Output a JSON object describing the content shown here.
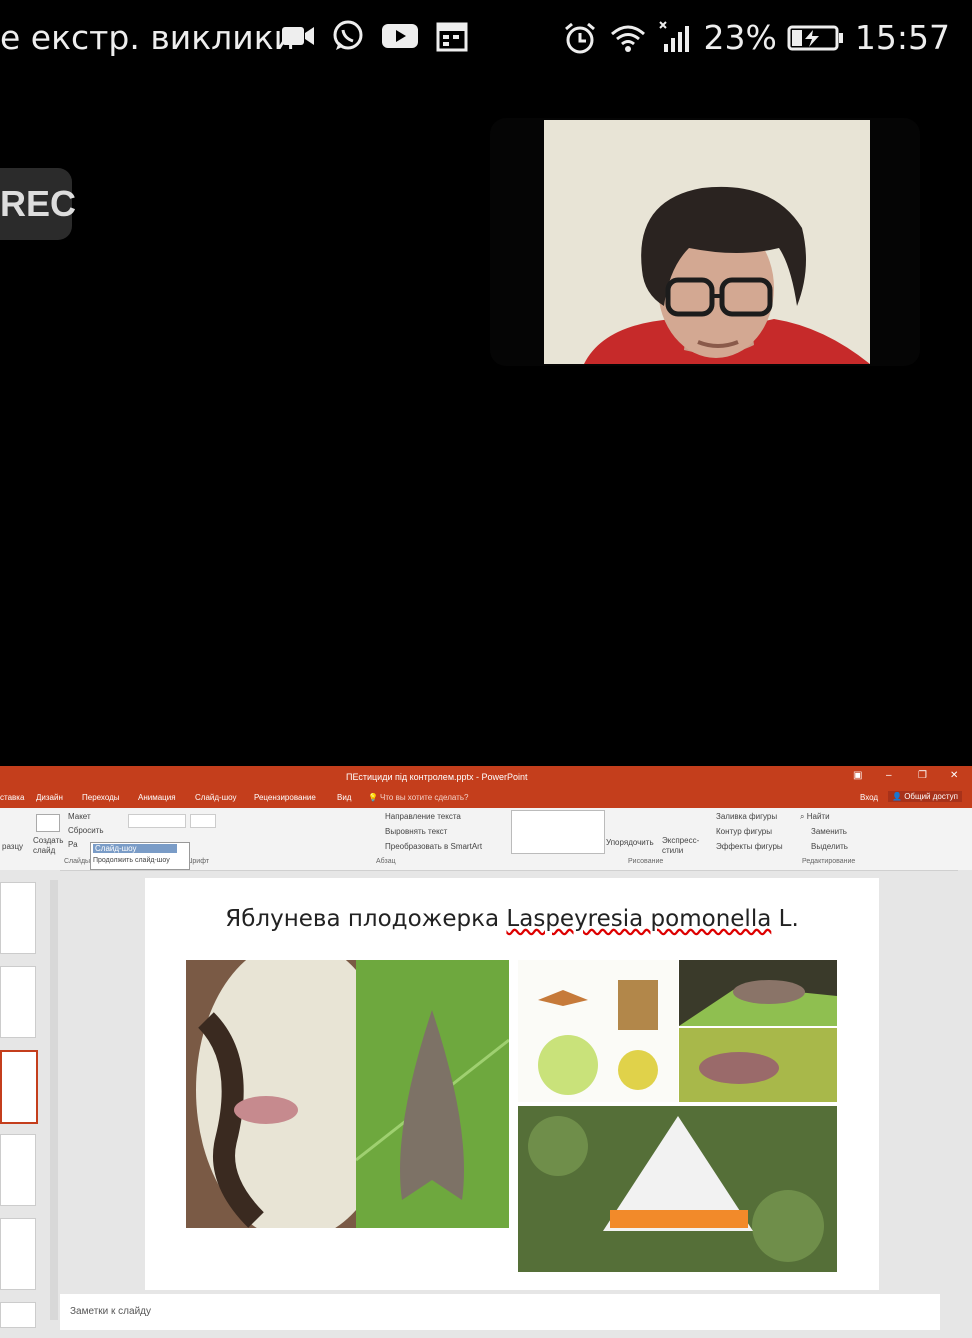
{
  "status_bar": {
    "call_text": "е екстр. виклики",
    "battery": "23%",
    "time": "15:57"
  },
  "rec_badge": "REC",
  "powerpoint": {
    "window_title": "ПЕстициди під контролем.pptx - PowerPoint",
    "menu": [
      "ставка",
      "Дизайн",
      "Переходы",
      "Анимация",
      "Слайд-шоу",
      "Рецензирование",
      "Вид"
    ],
    "tell_me": "Что вы хотите сделать?",
    "sign_in": "Вход",
    "share": "Общий доступ",
    "ribbon": {
      "layout": "Макет",
      "reset": "Сбросить",
      "new_slide": "Создать слайд",
      "by_sample": "разцу",
      "section": "Ра",
      "tooltip_title": "Слайд-шоу",
      "tooltip_item": "Продолжить слайд-шоу",
      "text_direction": "Направление текста",
      "align_text": "Выровнять текст",
      "smartart": "Преобразовать в SmartArt",
      "arrange": "Упорядочить",
      "quick_styles": "Экспресс-стили",
      "shape_fill": "Заливка фигуры",
      "shape_outline": "Контур фигуры",
      "shape_effects": "Эффекты фигуры",
      "find": "Найти",
      "replace": "Заменить",
      "select": "Выделить",
      "group_slides": "Слайды",
      "group_font": "Шрифт",
      "group_paragraph": "Абзац",
      "group_drawing": "Рисование",
      "group_editing": "Редактирование"
    },
    "slide": {
      "title_plain": "Яблунева плодожерка ",
      "title_sci": "Laspeyresia pomonella",
      "title_end": " L."
    },
    "notes_placeholder": "Заметки к слайду"
  }
}
